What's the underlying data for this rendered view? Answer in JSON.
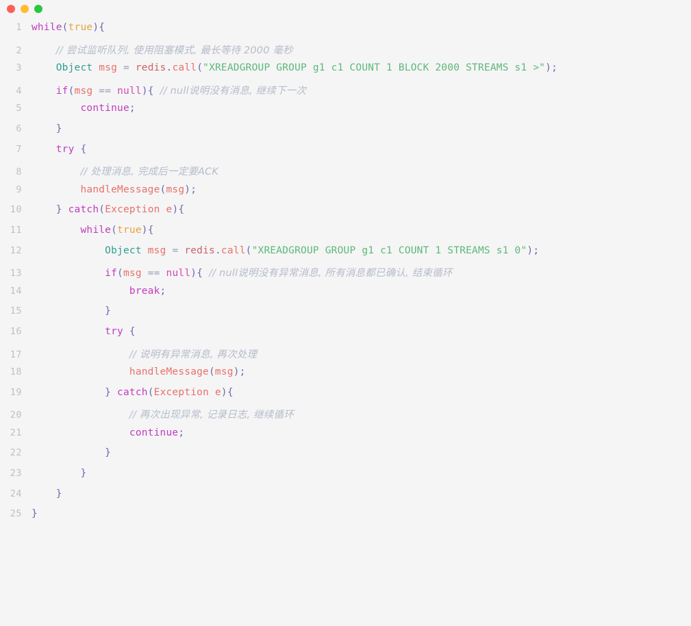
{
  "window": {
    "traffic_lights": [
      {
        "name": "close-button",
        "color": "#ff5f57"
      },
      {
        "name": "minimize-button",
        "color": "#febc2e"
      },
      {
        "name": "maximize-button",
        "color": "#28c840"
      }
    ]
  },
  "editor": {
    "language": "java",
    "background": "#f5f5f5",
    "line_number_color": "#bfbfbf",
    "total_lines": 25,
    "lines": [
      {
        "n": "1",
        "text": "while(true){"
      },
      {
        "n": "2",
        "text": "    // 尝试监听队列, 使用阻塞模式, 最长等待 2000 毫秒"
      },
      {
        "n": "3",
        "text": "    Object msg = redis.call(\"XREADGROUP GROUP g1 c1 COUNT 1 BLOCK 2000 STREAMS s1 >\");"
      },
      {
        "n": "4",
        "text": "    if(msg == null){ // null说明没有消息, 继续下一次"
      },
      {
        "n": "5",
        "text": "        continue;"
      },
      {
        "n": "6",
        "text": "    }"
      },
      {
        "n": "7",
        "text": "    try {"
      },
      {
        "n": "8",
        "text": "        // 处理消息, 完成后一定要ACK"
      },
      {
        "n": "9",
        "text": "        handleMessage(msg);"
      },
      {
        "n": "10",
        "text": "    } catch(Exception e){"
      },
      {
        "n": "11",
        "text": "        while(true){"
      },
      {
        "n": "12",
        "text": "            Object msg = redis.call(\"XREADGROUP GROUP g1 c1 COUNT 1 STREAMS s1 0\");"
      },
      {
        "n": "13",
        "text": "            if(msg == null){ // null说明没有异常消息, 所有消息都已确认, 结束循环"
      },
      {
        "n": "14",
        "text": "                break;"
      },
      {
        "n": "15",
        "text": "            }"
      },
      {
        "n": "16",
        "text": "            try {"
      },
      {
        "n": "17",
        "text": "                // 说明有异常消息, 再次处理"
      },
      {
        "n": "18",
        "text": "                handleMessage(msg);"
      },
      {
        "n": "19",
        "text": "            } catch(Exception e){"
      },
      {
        "n": "20",
        "text": "                // 再次出现异常, 记录日志, 继续循环"
      },
      {
        "n": "21",
        "text": "                continue;"
      },
      {
        "n": "22",
        "text": "            }"
      },
      {
        "n": "23",
        "text": "        }"
      },
      {
        "n": "24",
        "text": "    }"
      },
      {
        "n": "25",
        "text": "}"
      }
    ]
  },
  "tokens": {
    "keyword_color": "#c03cc0",
    "string_color": "#5cb87a",
    "number_color": "#e8a33d",
    "comment_color": "#b6bccb",
    "type_color": "#2e9e8f",
    "function_color": "#e8706a",
    "punctuation_color": "#6a6ab0"
  }
}
